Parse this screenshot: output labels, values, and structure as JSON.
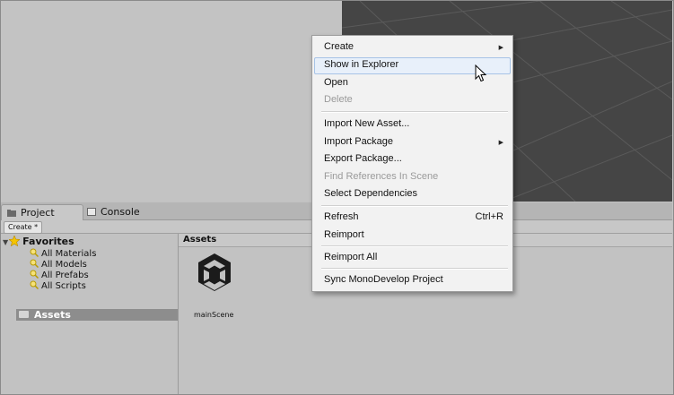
{
  "panel_tabs": {
    "project": "Project",
    "console": "Console"
  },
  "toolbar": {
    "create": "Create *"
  },
  "favorites": {
    "header": "Favorites",
    "items": [
      "All Materials",
      "All Models",
      "All Prefabs",
      "All Scripts"
    ]
  },
  "tree": {
    "assets": "Assets"
  },
  "assets_panel": {
    "header": "Assets",
    "items": [
      {
        "label": "mainScene",
        "icon": "unity-scene-icon"
      }
    ]
  },
  "context_menu": {
    "items": [
      {
        "label": "Create",
        "submenu": true,
        "disabled": false
      },
      {
        "label": "Show in Explorer",
        "submenu": false,
        "disabled": false,
        "highlighted": true
      },
      {
        "label": "Open",
        "submenu": false,
        "disabled": false
      },
      {
        "label": "Delete",
        "submenu": false,
        "disabled": true
      },
      {
        "label": "Import New Asset...",
        "submenu": false,
        "disabled": false
      },
      {
        "label": "Import Package",
        "submenu": true,
        "disabled": false
      },
      {
        "label": "Export Package...",
        "submenu": false,
        "disabled": false
      },
      {
        "label": "Find References In Scene",
        "submenu": false,
        "disabled": true
      },
      {
        "label": "Select Dependencies",
        "submenu": false,
        "disabled": false
      },
      {
        "label": "Refresh",
        "submenu": false,
        "disabled": false,
        "shortcut": "Ctrl+R"
      },
      {
        "label": "Reimport",
        "submenu": false,
        "disabled": false
      },
      {
        "label": "Reimport All",
        "submenu": false,
        "disabled": false
      },
      {
        "label": "Sync MonoDevelop Project",
        "submenu": false,
        "disabled": false
      }
    ]
  },
  "colors": {
    "scene_background": "#454545",
    "panel_background": "#c2c2c2",
    "selection": "#8d8d8d",
    "menu_highlight": "#e8f0fa",
    "favorites_star": "#f5c400"
  }
}
